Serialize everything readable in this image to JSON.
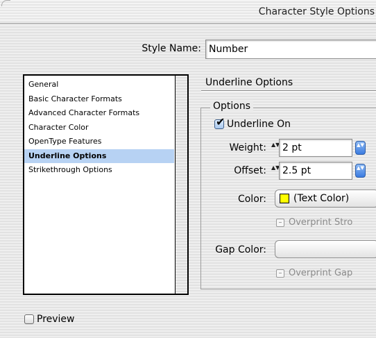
{
  "window": {
    "title": "Character Style Options"
  },
  "style_name": {
    "label": "Style Name:",
    "value": "Number"
  },
  "sidebar": {
    "items": [
      {
        "label": "General",
        "selected": false
      },
      {
        "label": "Basic Character Formats",
        "selected": false
      },
      {
        "label": "Advanced Character Formats",
        "selected": false
      },
      {
        "label": "Character Color",
        "selected": false
      },
      {
        "label": "OpenType Features",
        "selected": false
      },
      {
        "label": "Underline Options",
        "selected": true
      },
      {
        "label": "Strikethrough Options",
        "selected": false
      }
    ]
  },
  "panel": {
    "heading": "Underline Options",
    "group_label": "Options",
    "underline_on": {
      "label": "Underline On",
      "checked": true
    },
    "weight": {
      "label": "Weight:",
      "value": "2 pt"
    },
    "offset": {
      "label": "Offset:",
      "value": "2.5 pt"
    },
    "color": {
      "label": "Color:",
      "value": "(Text Color)",
      "swatch": "#ffff00"
    },
    "overprint_stroke": {
      "label": "Overprint Stro",
      "enabled": false
    },
    "gap_color": {
      "label": "Gap Color:",
      "value": ""
    },
    "overprint_gap": {
      "label": "Overprint Gap",
      "enabled": false
    }
  },
  "preview": {
    "label": "Preview",
    "checked": false
  },
  "icons": {
    "checkmark": "✔",
    "stepper": "▲▼",
    "popup_arrows": "▲▼",
    "disabled_check": "–"
  },
  "colors": {
    "selection": "#b7d2f3",
    "popup_button": "#3b7be0"
  }
}
